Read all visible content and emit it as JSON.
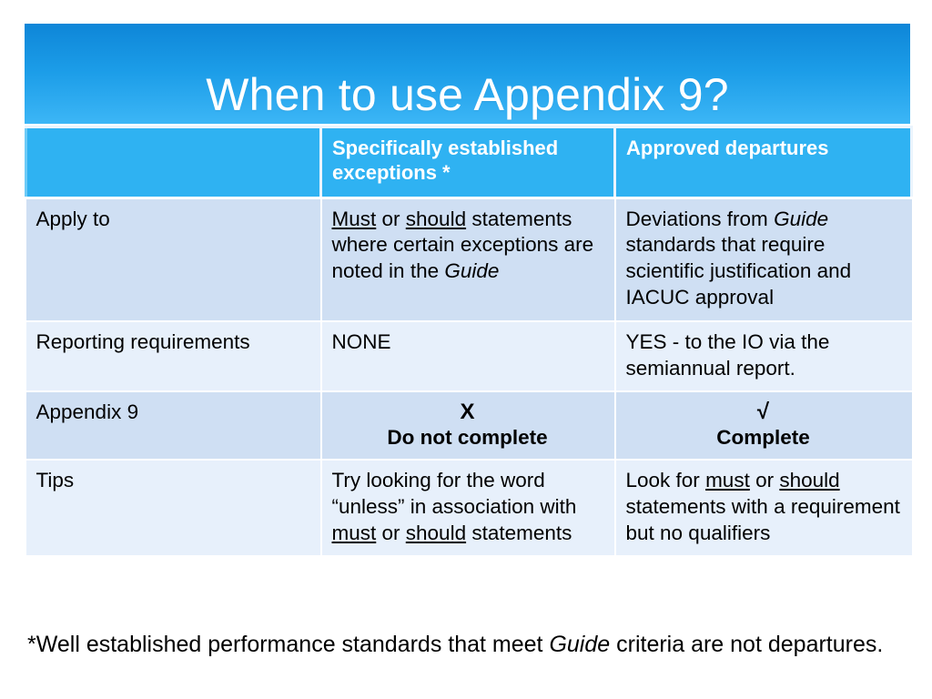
{
  "slide": {
    "title": "When to use Appendix 9?",
    "accent_banner_top": "#0e86d8",
    "accent_banner_bottom": "#3cb6f6",
    "header_fill": "#2fb2f2",
    "row_shade_dark": "#cfdff3",
    "row_shade_light": "#e7f0fb"
  },
  "table": {
    "headers": {
      "col1": "",
      "col2": "Specifically established exceptions *",
      "col3": "Approved departures"
    },
    "rows": [
      {
        "label": "Apply to",
        "col2_parts": [
          {
            "text": "Must",
            "style": "underline"
          },
          {
            "text": " or ",
            "style": "normal"
          },
          {
            "text": "should",
            "style": "underline"
          },
          {
            "text": " statements where certain exceptions are noted in the ",
            "style": "normal"
          },
          {
            "text": "Guide",
            "style": "italic"
          }
        ],
        "col2_plain": "Must or should statements where certain exceptions are noted in the Guide",
        "col3_parts": [
          {
            "text": "Deviations from ",
            "style": "normal"
          },
          {
            "text": "Guide",
            "style": "italic"
          },
          {
            "text": " standards that require scientific justification and IACUC approval",
            "style": "normal"
          }
        ],
        "col3_plain": "Deviations from Guide standards that require scientific justification and IACUC approval"
      },
      {
        "label": "Reporting requirements",
        "col2_plain": "NONE",
        "col3_plain": "YES - to the IO via the semiannual report."
      },
      {
        "label": "Appendix 9",
        "col2_glyph": "X",
        "col2_glyph_label": "Do not complete",
        "col3_glyph": "√",
        "col3_glyph_label": "Complete"
      },
      {
        "label": "Tips",
        "col2_parts": [
          {
            "text": "Try looking for the word “unless” in association with ",
            "style": "normal"
          },
          {
            "text": "must",
            "style": "underline"
          },
          {
            "text": " or ",
            "style": "normal"
          },
          {
            "text": "should",
            "style": "underline"
          },
          {
            "text": " statements",
            "style": "normal"
          }
        ],
        "col2_plain": "Try looking for the word “unless” in association with must or should statements",
        "col3_parts": [
          {
            "text": "Look for ",
            "style": "normal"
          },
          {
            "text": "must",
            "style": "underline"
          },
          {
            "text": " or ",
            "style": "normal"
          },
          {
            "text": "should",
            "style": "underline"
          },
          {
            "text": " statements with a requirement but no qualifiers",
            "style": "normal"
          }
        ],
        "col3_plain": "Look for must or should statements with a requirement but no qualifiers"
      }
    ]
  },
  "footnote": {
    "parts": [
      {
        "text": "*Well established performance standards that meet ",
        "style": "normal"
      },
      {
        "text": "Guide",
        "style": "italic"
      },
      {
        "text": " criteria are not departures.",
        "style": "normal"
      }
    ],
    "plain": "*Well established performance standards that meet Guide criteria are not departures."
  }
}
